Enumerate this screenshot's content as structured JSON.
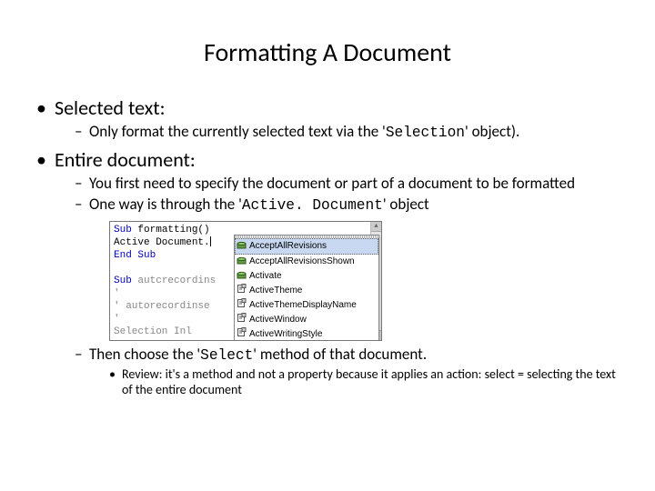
{
  "title": "Formatting A Document",
  "b1": {
    "heading": "Selected text:",
    "sub1_pre": "Only format the currently selected text via the '",
    "sub1_code": "Selection",
    "sub1_post": "' object)."
  },
  "b2": {
    "heading": "Entire document:",
    "sub1": "You first need to specify the document or part of a document to be formatted",
    "sub2_pre": "One way is through the '",
    "sub2_code": "Active. Document",
    "sub2_post": "' object",
    "sub3_pre": "Then choose the '",
    "sub3_code": "Select",
    "sub3_post": "' method of that document.",
    "review": "Review: it's a method and not a property because it applies an action: select = selecting the text of the entire document"
  },
  "editor": {
    "l1a": "Sub",
    "l1b": " formatting()",
    "l2": "    Active Document.",
    "l3a": "End",
    "l3b": " ",
    "l3c": "Sub",
    "l4a": "Sub",
    "l4b": " autcrecordins",
    "l5": "'",
    "l6": "'  autorecordinse",
    "l7": "'",
    "l8": "    Selection Inl"
  },
  "dropdown": {
    "items": [
      {
        "name": "AcceptAllRevisions",
        "icon": "method",
        "selected": true
      },
      {
        "name": "AcceptAllRevisionsShown",
        "icon": "method",
        "selected": false
      },
      {
        "name": "Activate",
        "icon": "method",
        "selected": false
      },
      {
        "name": "ActiveTheme",
        "icon": "property",
        "selected": false
      },
      {
        "name": "ActiveThemeDisplayName",
        "icon": "property",
        "selected": false
      },
      {
        "name": "ActiveWindow",
        "icon": "property",
        "selected": false
      },
      {
        "name": "ActiveWritingStyle",
        "icon": "property",
        "selected": false
      }
    ]
  }
}
